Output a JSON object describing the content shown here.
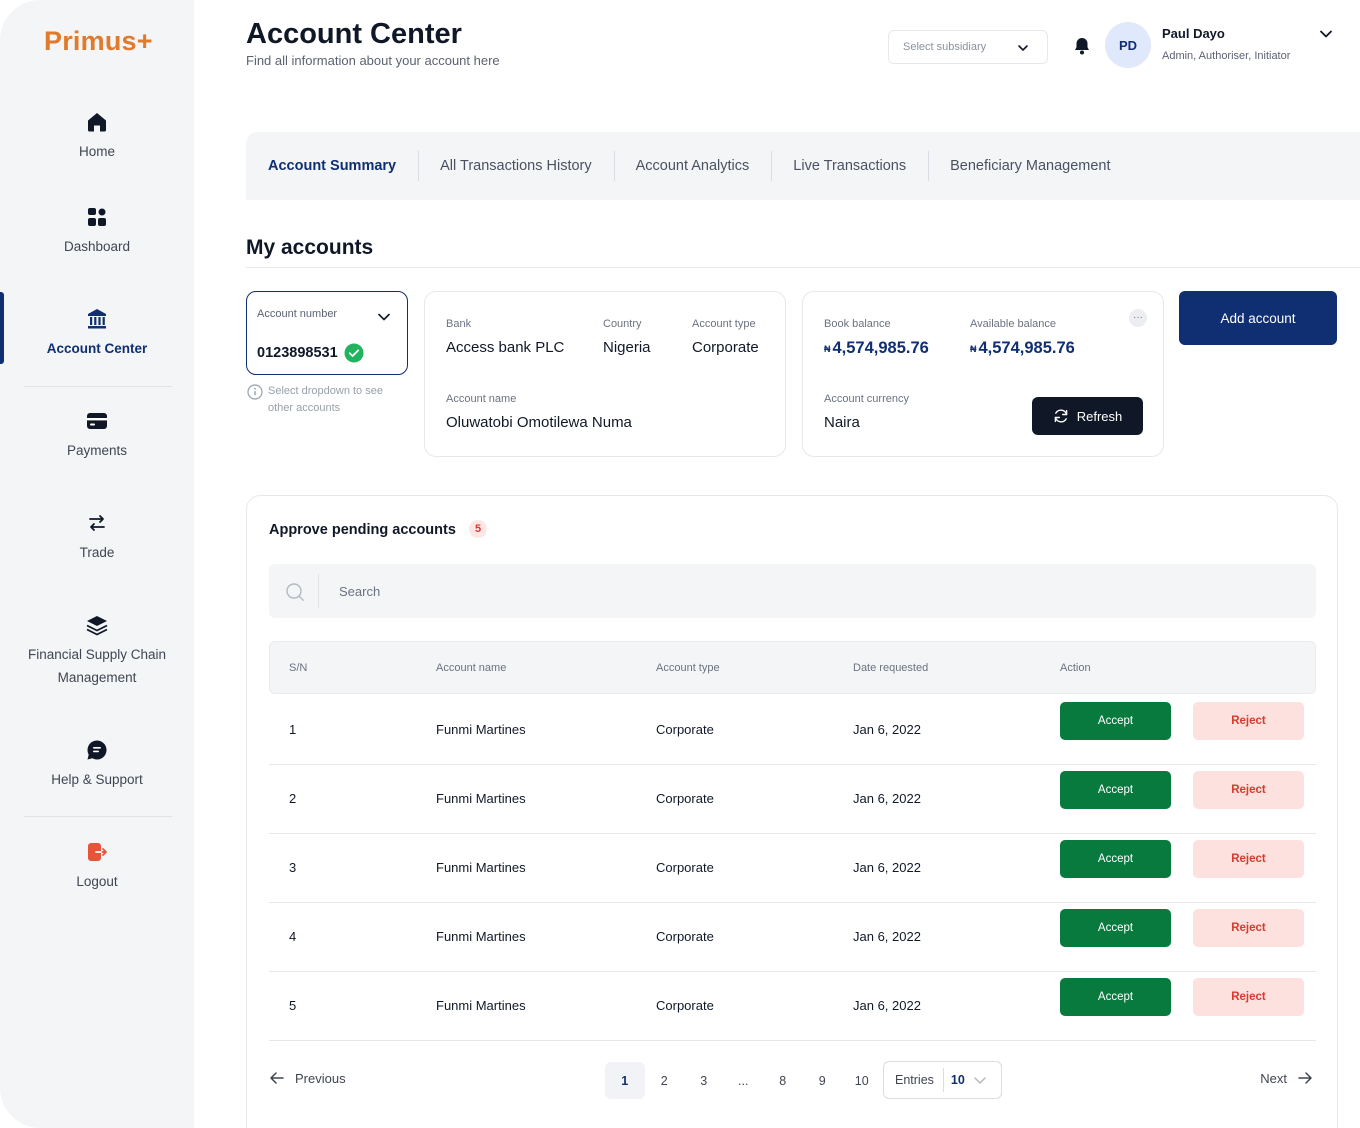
{
  "brand": {
    "name": "Primus+"
  },
  "sidebar": {
    "items": [
      {
        "label": "Home",
        "icon": "home-icon"
      },
      {
        "label": "Dashboard",
        "icon": "dashboard-icon"
      },
      {
        "label": "Account Center",
        "icon": "bank-icon",
        "active": true
      },
      {
        "label": "Payments",
        "icon": "card-icon"
      },
      {
        "label": "Trade",
        "icon": "swap-icon"
      },
      {
        "label": "Financial Supply Chain Management",
        "icon": "layers-icon"
      },
      {
        "label": "Help & Support",
        "icon": "help-chat-icon"
      },
      {
        "label": "Logout",
        "icon": "logout-icon"
      }
    ]
  },
  "header": {
    "title": "Account Center",
    "subtitle": "Find all information about your account here",
    "subsidiary_placeholder": "Select subsidiary",
    "user": {
      "initials": "PD",
      "name": "Paul Dayo",
      "role": "Admin, Authoriser, Initiator"
    }
  },
  "tabs": [
    {
      "label": "Account Summary",
      "active": true
    },
    {
      "label": "All Transactions History"
    },
    {
      "label": "Account Analytics"
    },
    {
      "label": "Live Transactions"
    },
    {
      "label": "Beneficiary Management"
    }
  ],
  "accounts": {
    "section_title": "My accounts",
    "account_number_label": "Account number",
    "account_number": "0123898531",
    "hint": "Select dropdown to see other accounts",
    "bank_label": "Bank",
    "bank": "Access bank PLC",
    "country_label": "Country",
    "country": "Nigeria",
    "type_label": "Account type",
    "type": "Corporate",
    "name_label": "Account name",
    "name": "Oluwatobi Omotilewa Numa",
    "book_balance_label": "Book balance",
    "book_balance": "4,574,985.76",
    "available_balance_label": "Available balance",
    "available_balance": "4,574,985.76",
    "currency_symbol": "₦",
    "currency_label": "Account currency",
    "currency": "Naira",
    "more_label": "···",
    "refresh_label": "Refresh",
    "add_account_label": "Add account"
  },
  "pending": {
    "title": "Approve pending accounts",
    "count": "5",
    "search_placeholder": "Search",
    "columns": [
      "S/N",
      "Account name",
      "Account type",
      "Date requested",
      "Action"
    ],
    "accept_label": "Accept",
    "reject_label": "Reject",
    "rows": [
      {
        "sn": "1",
        "name": "Funmi Martines",
        "type": "Corporate",
        "date": "Jan 6, 2022"
      },
      {
        "sn": "2",
        "name": "Funmi Martines",
        "type": "Corporate",
        "date": "Jan 6, 2022"
      },
      {
        "sn": "3",
        "name": "Funmi Martines",
        "type": "Corporate",
        "date": "Jan 6, 2022"
      },
      {
        "sn": "4",
        "name": "Funmi Martines",
        "type": "Corporate",
        "date": "Jan 6, 2022"
      },
      {
        "sn": "5",
        "name": "Funmi Martines",
        "type": "Corporate",
        "date": "Jan 6, 2022"
      }
    ]
  },
  "pagination": {
    "previous_label": "Previous",
    "next_label": "Next",
    "pages": [
      "1",
      "2",
      "3",
      "...",
      "8",
      "9",
      "10"
    ],
    "current_page": "1",
    "entries_label": "Entries",
    "entries_value": "10"
  },
  "colors": {
    "brand": "#e07a2c",
    "primary": "#0f2f72",
    "accept": "#087a3e",
    "reject_bg": "#fde1df",
    "reject_text": "#d63b2f"
  }
}
